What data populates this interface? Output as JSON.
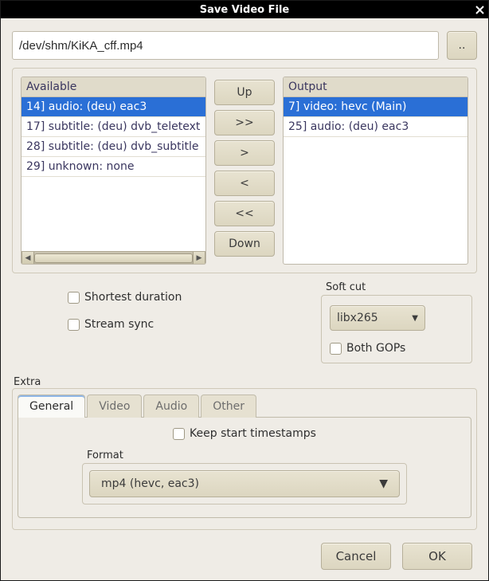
{
  "title": "Save Video File",
  "path": {
    "value": "/dev/shm/KiKA_cff.mp4",
    "browse_label": ".."
  },
  "available": {
    "header": "Available",
    "items": [
      "14] audio: (deu) eac3",
      "17] subtitle: (deu) dvb_teletext",
      "28] subtitle: (deu) dvb_subtitle",
      "29] unknown: none"
    ],
    "selected_index": 0
  },
  "output": {
    "header": "Output",
    "items": [
      "7] video: hevc (Main)",
      "25] audio: (deu) eac3"
    ],
    "selected_index": 0
  },
  "move_buttons": {
    "up": "Up",
    "add_all": ">>",
    "add": ">",
    "remove": "<",
    "remove_all": "<<",
    "down": "Down"
  },
  "options": {
    "shortest_label": "Shortest duration",
    "streamsync_label": "Stream sync"
  },
  "softcut": {
    "group_label": "Soft cut",
    "codec": "libx265",
    "bothgops_label": "Both GOPs"
  },
  "extra": {
    "group_label": "Extra",
    "tabs": {
      "general": "General",
      "video": "Video",
      "audio": "Audio",
      "other": "Other"
    },
    "active_tab": "general",
    "keepts_label": "Keep start timestamps",
    "format": {
      "label": "Format",
      "value": "mp4 (hevc, eac3)"
    }
  },
  "footer": {
    "cancel": "Cancel",
    "ok": "OK"
  }
}
